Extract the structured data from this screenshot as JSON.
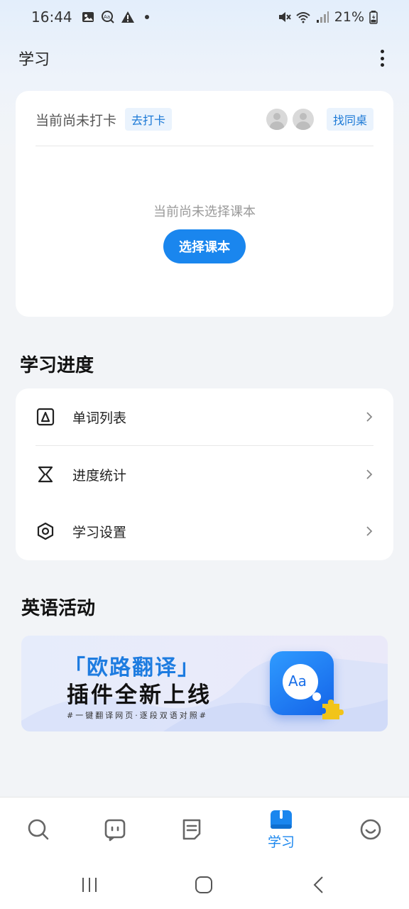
{
  "status_bar": {
    "time": "16:44",
    "battery": "21%",
    "icons_left": [
      "gallery-icon",
      "dictionary-icon",
      "alert-icon"
    ],
    "icons_right": [
      "mute-icon",
      "wifi-icon",
      "signal-icon",
      "battery-icon"
    ]
  },
  "header": {
    "title": "学习"
  },
  "checkin_card": {
    "status_text": "当前尚未打卡",
    "checkin_button": "去打卡",
    "find_partner_button": "找同桌",
    "empty_text": "当前尚未选择课本",
    "select_book_button": "选择课本"
  },
  "progress_section": {
    "title": "学习进度",
    "items": [
      {
        "label": "单词列表",
        "icon": "word-list-icon"
      },
      {
        "label": "进度统计",
        "icon": "hourglass-icon"
      },
      {
        "label": "学习设置",
        "icon": "settings-icon"
      }
    ]
  },
  "activity_section": {
    "title": "英语活动",
    "banner": {
      "title_line1": "「欧路翻译」",
      "title_line2": "插件全新上线",
      "subtitle": "#一键翻译网页·逐段双语对照#",
      "logo_text": "Aa"
    }
  },
  "bottom_nav": {
    "items": [
      {
        "name": "search",
        "icon": "search-icon",
        "label": ""
      },
      {
        "name": "assistant",
        "icon": "robot-icon",
        "label": ""
      },
      {
        "name": "notes",
        "icon": "document-icon",
        "label": ""
      },
      {
        "name": "study",
        "icon": "book-icon",
        "label": "学习",
        "active": true
      },
      {
        "name": "me",
        "icon": "smile-icon",
        "label": ""
      }
    ]
  },
  "colors": {
    "accent": "#1a86ee",
    "background": "#f2f4f7",
    "card": "#ffffff",
    "tag_bg": "#eaf3fd"
  }
}
